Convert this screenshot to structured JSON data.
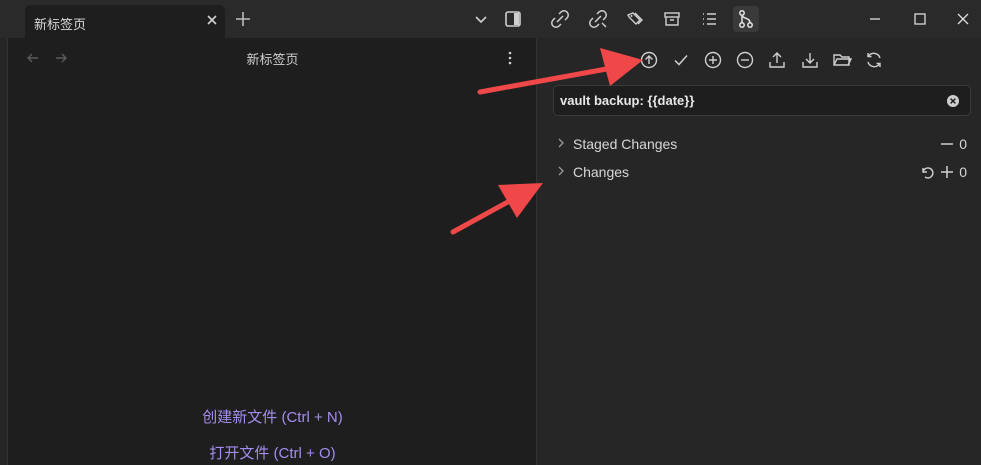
{
  "tab": {
    "title": "新标签页"
  },
  "view": {
    "title": "新标签页"
  },
  "empty_state": {
    "create_file": "创建新文件 (Ctrl + N)",
    "open_file": "打开文件 (Ctrl + O)"
  },
  "git": {
    "commit_message": "vault backup: {{date}}",
    "sections": [
      {
        "label": "Staged Changes",
        "count": "0"
      },
      {
        "label": "Changes",
        "count": "0"
      }
    ]
  },
  "colors": {
    "accent": "#a58cf0",
    "annotation_arrow": "#f04848"
  }
}
